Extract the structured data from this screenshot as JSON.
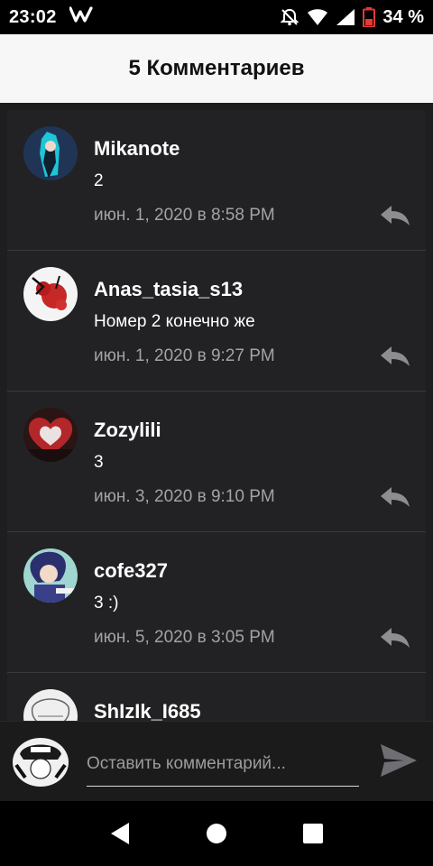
{
  "status_bar": {
    "time": "23:02",
    "app_icon": "w-logo-icon",
    "battery": "34 %"
  },
  "header": {
    "title": "5 Комментариев"
  },
  "comments": [
    {
      "author": "Mikanote",
      "text": "2",
      "date": "июн. 1, 2020 в 8:58 PM",
      "avatar": "anime-girl-dark-avatar"
    },
    {
      "author": "Anas_tasia_s13",
      "text": "Номер 2 конечно же",
      "date": "июн. 1, 2020 в 9:27 PM",
      "avatar": "red-flowers-avatar"
    },
    {
      "author": "Zozylili",
      "text": "3",
      "date": "июн. 3, 2020 в 9:10 PM",
      "avatar": "red-heart-avatar"
    },
    {
      "author": "cofe327",
      "text": "3 :)",
      "date": "июн. 5, 2020 в 3:05 PM",
      "avatar": "anime-boy-avatar"
    },
    {
      "author": "ShIzIk_I685",
      "text": "",
      "date": "",
      "avatar": "sketch-avatar"
    }
  ],
  "input": {
    "placeholder": "Оставить комментарий...",
    "value": ""
  },
  "colors": {
    "header_bg": "#f7f7f7",
    "panel_bg": "#222224",
    "date_text": "#a3a3a6",
    "reply_icon": "#8e8e91"
  }
}
